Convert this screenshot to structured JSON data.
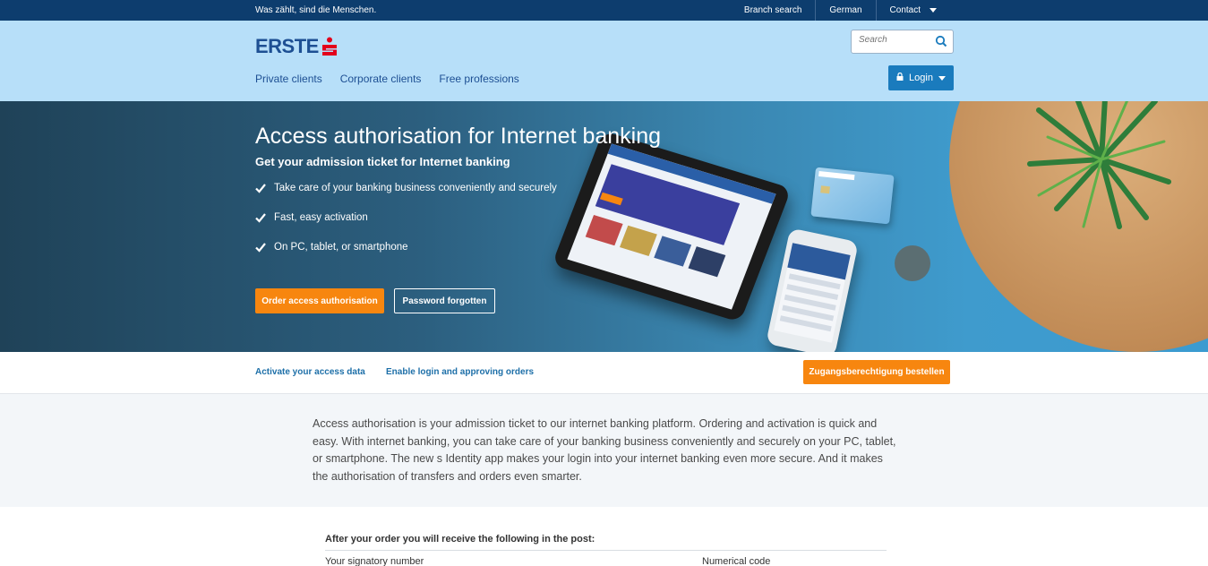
{
  "topbar": {
    "slogan": "Was zählt, sind die Menschen.",
    "links": [
      "Branch search",
      "German",
      "Contact"
    ]
  },
  "header": {
    "logo_text": "ERSTE",
    "search_placeholder": "Search",
    "nav": [
      "Private clients",
      "Corporate clients",
      "Free professions"
    ],
    "login_label": "Login"
  },
  "hero": {
    "title": "Access authorisation for Internet banking",
    "subtitle": "Get your admission ticket for Internet banking",
    "checks": [
      "Take care of your banking business conveniently and securely",
      "Fast, easy activation",
      "On PC, tablet, or smartphone"
    ],
    "order_button": "Order access authorisation",
    "password_button": "Password forgotten"
  },
  "subnav": {
    "links": [
      "Activate your access data",
      "Enable login and approving orders"
    ],
    "button": "Zugangsberechtigung bestellen"
  },
  "intro": {
    "text": "Access authorisation is your admission ticket to our internet banking platform. Ordering and activation is quick and easy. With internet banking, you can take care of your banking business conveniently and securely on your PC, tablet, or smartphone. The new s Identity app makes your login into your internet banking even more secure. And it makes the authorisation of transfers and orders even smarter."
  },
  "details": {
    "heading": "After your order you will receive the following in the post:",
    "col1": "Your signatory number",
    "col2": "Numerical code"
  },
  "colors": {
    "topbar": "#0d3d6e",
    "header": "#b7dff9",
    "accent_orange": "#f7860f",
    "login_blue": "#1a7bbd",
    "link_blue": "#1d6fa8"
  },
  "icons": [
    "search-icon",
    "lock-icon",
    "chevron-down-icon",
    "check-icon",
    "erste-s-logo-icon"
  ]
}
